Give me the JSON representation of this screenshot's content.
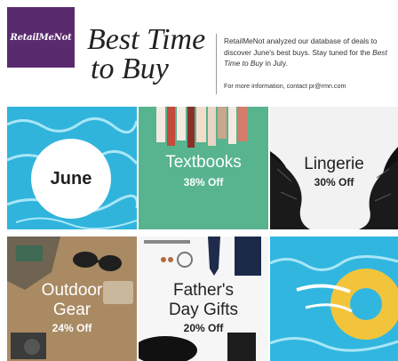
{
  "header": {
    "logo_text": "RetailMeNot",
    "title_line1": "Best Time",
    "title_line2": "to Buy",
    "desc_part1": "RetailMeNot analyzed our database of deals to discover June's best buys. Stay tuned for the ",
    "desc_em": "Best Time to Buy",
    "desc_part2": " in July.",
    "contact": "For more information, contact pr@rmn.com"
  },
  "tiles": {
    "month": "June",
    "textbooks": {
      "category": "Textbooks",
      "deal": "38% Off"
    },
    "lingerie": {
      "category": "Lingerie",
      "deal": "30% Off"
    },
    "outdoor": {
      "category_line1": "Outdoor",
      "category_line2": "Gear",
      "deal": "24% Off"
    },
    "fathers": {
      "category_line1": "Father's",
      "category_line2": "Day Gifts",
      "deal": "20% Off"
    }
  },
  "colors": {
    "brand_purple": "#5a2a6e",
    "pool_blue": "#30b4dc",
    "textbook_green": "#58b38f",
    "float_yellow": "#f2c43c"
  }
}
